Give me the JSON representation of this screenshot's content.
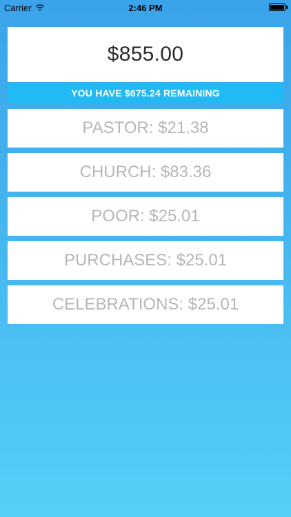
{
  "status_bar": {
    "carrier": "Carrier",
    "time": "2:46 PM",
    "icons": [
      "wifi-icon",
      "battery-icon"
    ]
  },
  "budget": {
    "total": "$855.00",
    "remaining_text": "YOU HAVE $675.24 REMAINING"
  },
  "categories": [
    {
      "label": "PASTOR: $21.38"
    },
    {
      "label": "CHURCH: $83.36"
    },
    {
      "label": "POOR: $25.01"
    },
    {
      "label": "PURCHASES: $25.01"
    },
    {
      "label": "CELEBRATIONS: $25.01"
    }
  ],
  "colors": {
    "background_top": "#3aa3ea",
    "background_bottom": "#56cff7",
    "banner": "#20baf5",
    "category_text": "#b6b6b6"
  }
}
